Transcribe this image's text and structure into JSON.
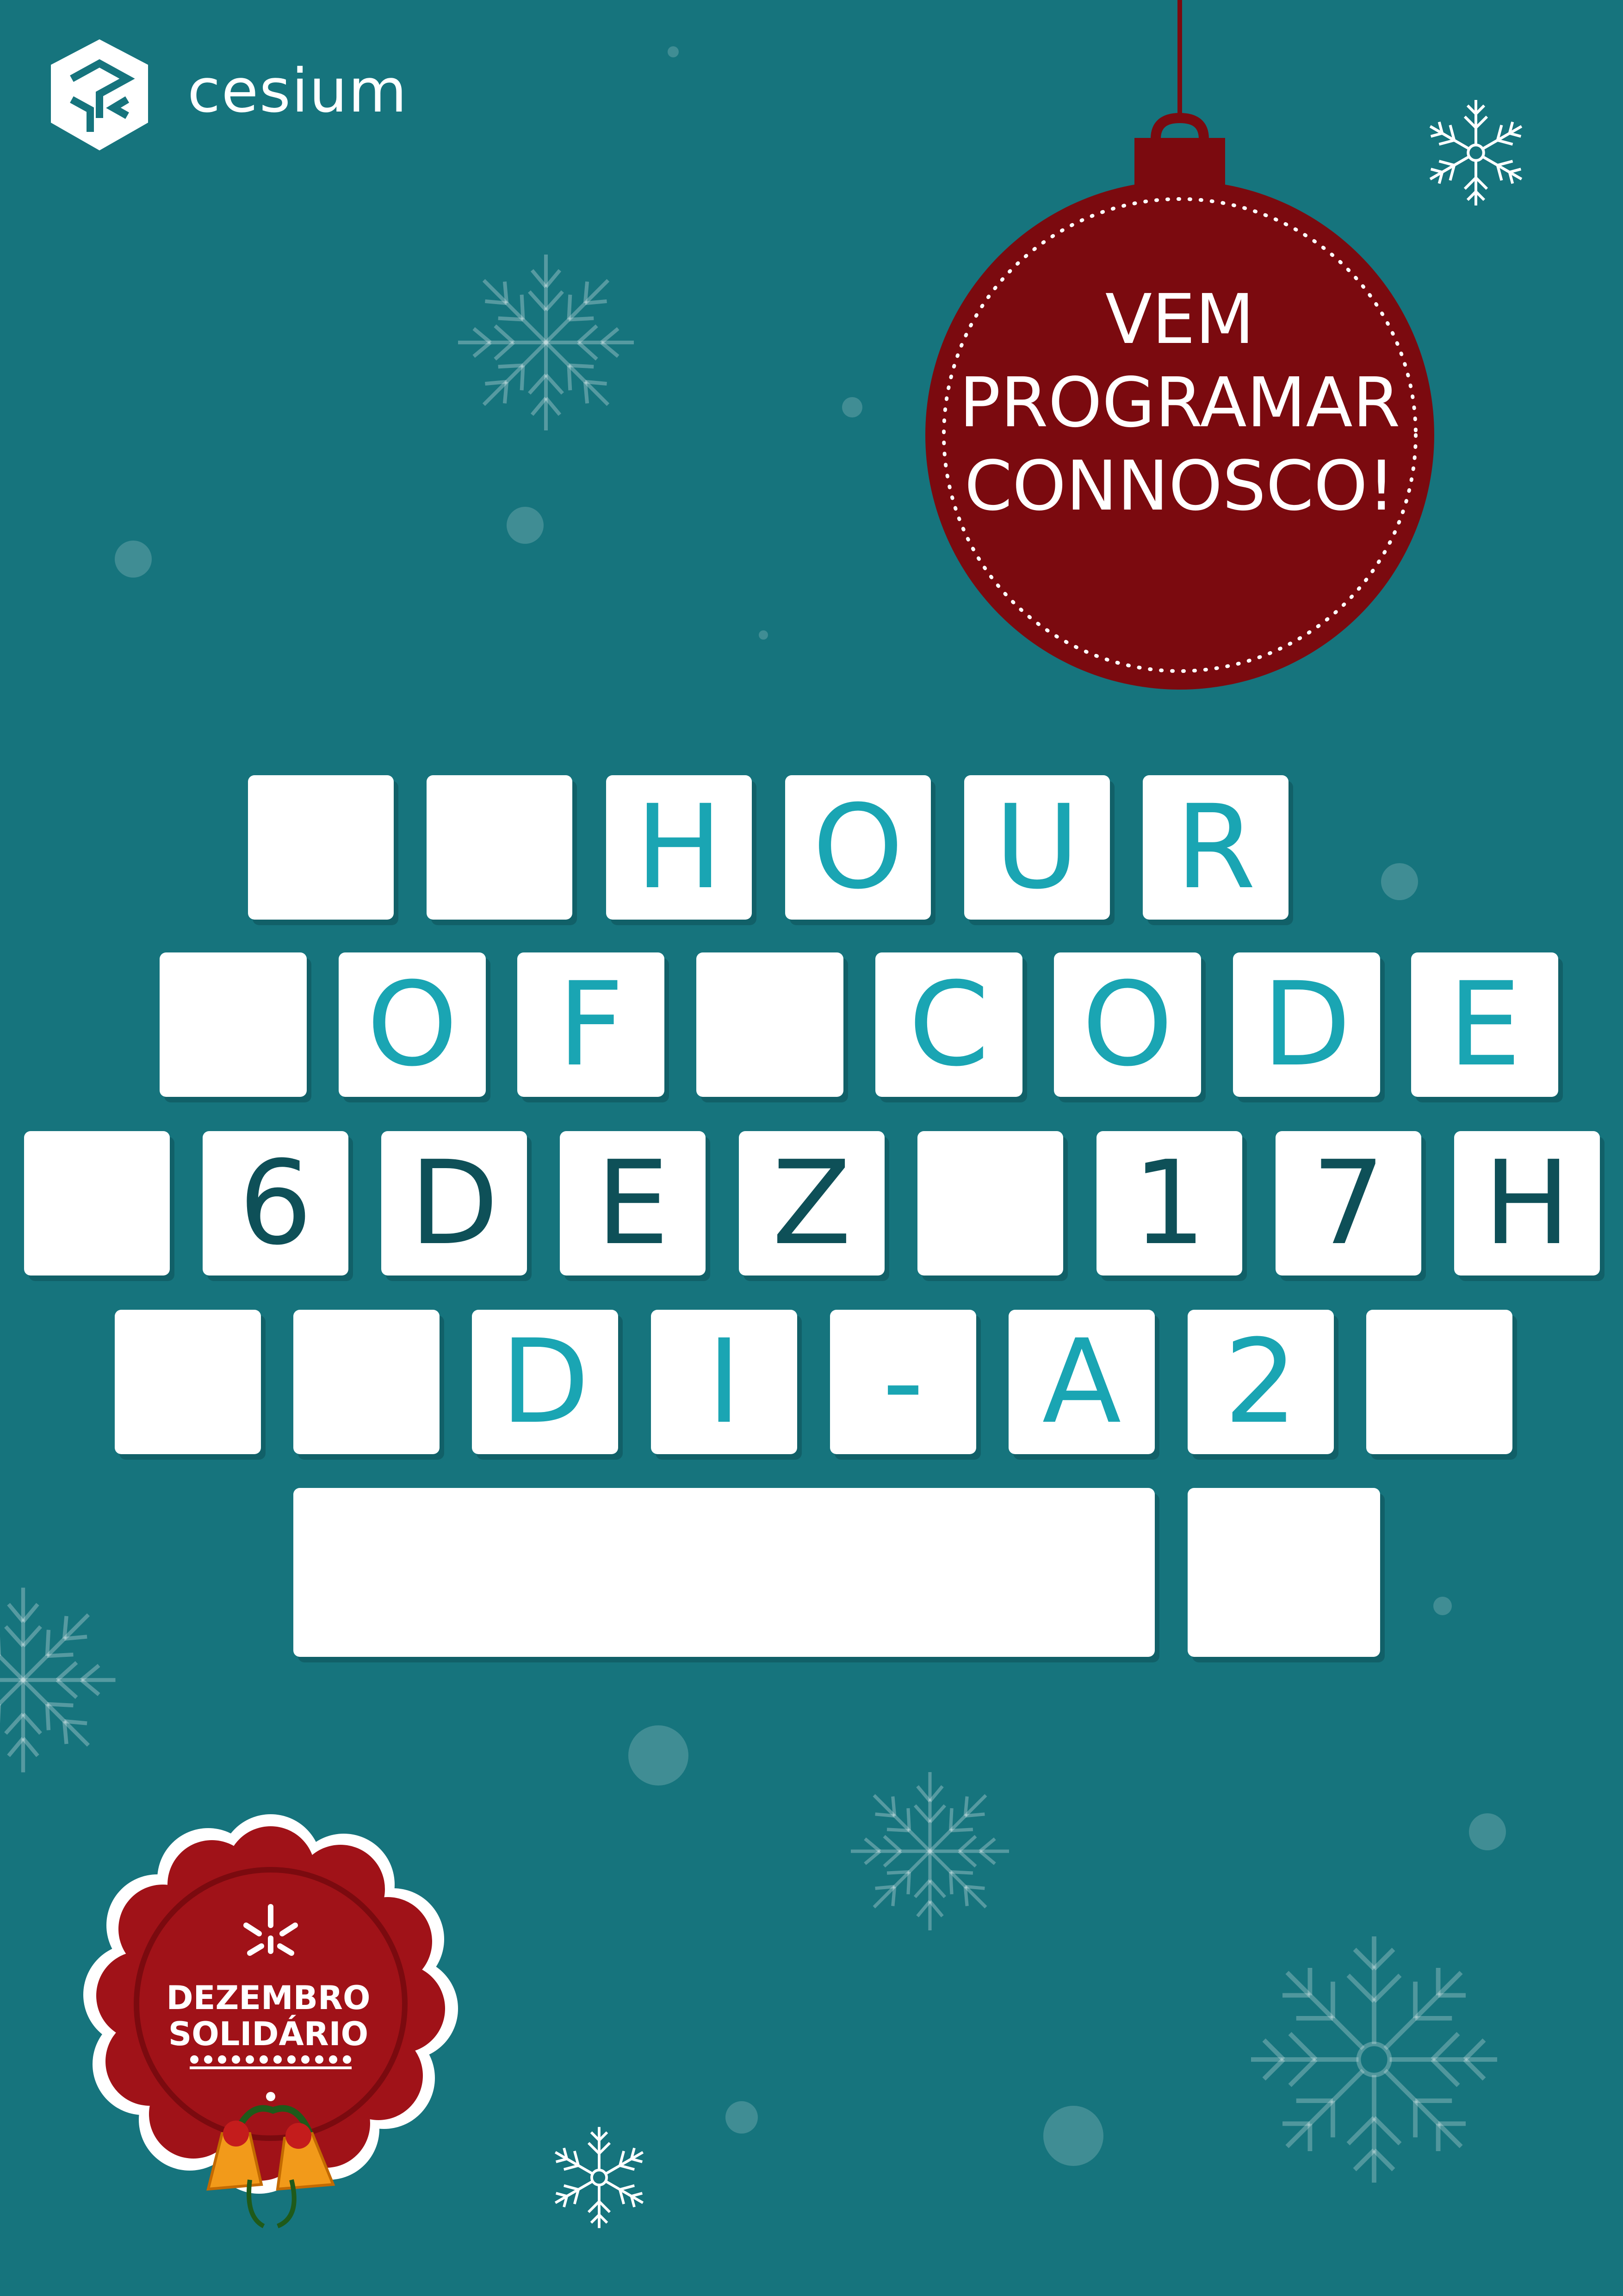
{
  "brand": {
    "name": "cesium"
  },
  "ornament": {
    "lines": [
      "VEM",
      "PROGRAMAR",
      "CONNOSCO!"
    ],
    "color": "#7b0a0f"
  },
  "keyboard": {
    "row1": [
      "",
      "",
      "H",
      "O",
      "U",
      "R"
    ],
    "row2": [
      "",
      "O",
      "F",
      "",
      "C",
      "O",
      "D",
      "E"
    ],
    "row3": [
      "",
      "6",
      "D",
      "E",
      "Z",
      "",
      "1",
      "7",
      "H"
    ],
    "row4": [
      "",
      "",
      "D",
      "I",
      "-",
      "A",
      "2",
      ""
    ]
  },
  "badge": {
    "line1": "DEZEMBRO",
    "line2": "SOLIDÁRIO",
    "color": "#a01218"
  },
  "colors": {
    "background": "#16747d",
    "accent_text": "#1aa5b3",
    "dark_text": "#0e5058"
  }
}
